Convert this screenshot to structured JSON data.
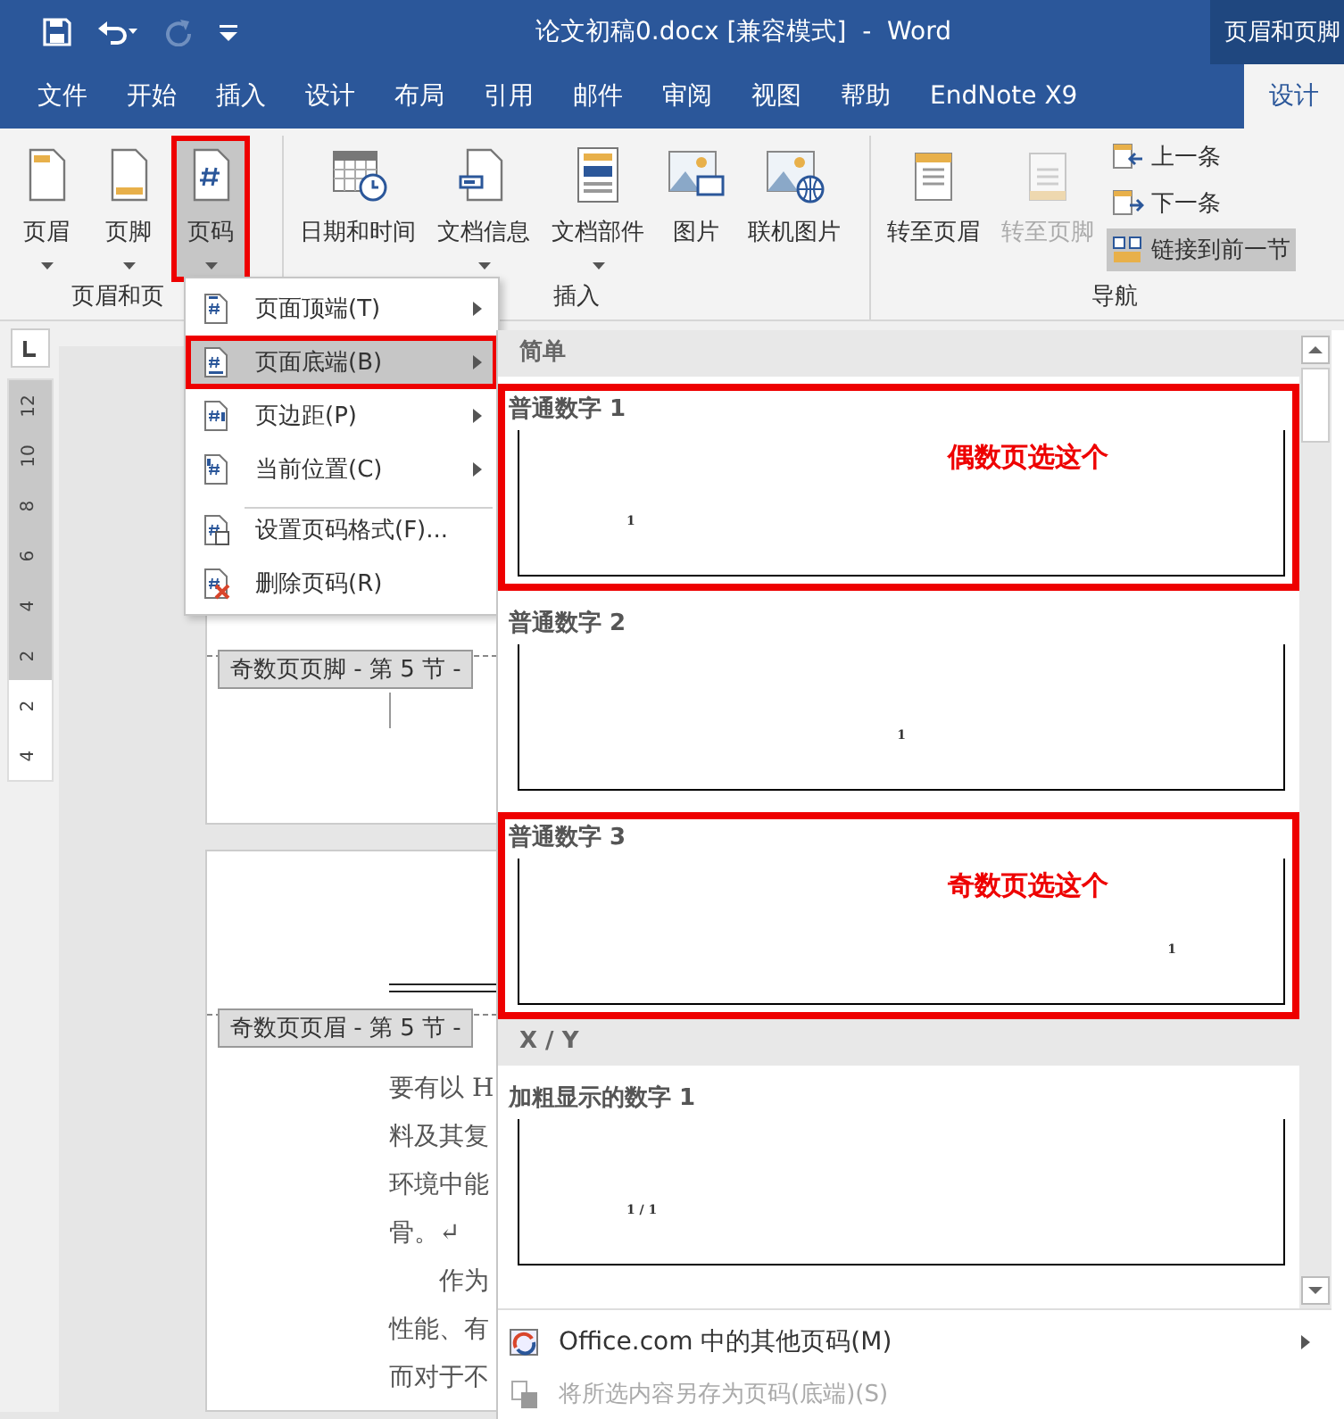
{
  "window": {
    "title": "论文初稿0.docx [兼容模式]  -  Word",
    "context_tab_group": "页眉和页脚"
  },
  "quick_access": [
    {
      "kind": "save",
      "disabled": false
    },
    {
      "kind": "undo",
      "disabled": false
    },
    {
      "kind": "redo",
      "disabled": true
    },
    {
      "kind": "customize",
      "disabled": false
    }
  ],
  "tabs": [
    {
      "label": "文件",
      "selected": false,
      "contextual": false
    },
    {
      "label": "开始",
      "selected": false,
      "contextual": false
    },
    {
      "label": "插入",
      "selected": false,
      "contextual": false
    },
    {
      "label": "设计",
      "selected": false,
      "contextual": false
    },
    {
      "label": "布局",
      "selected": false,
      "contextual": false
    },
    {
      "label": "引用",
      "selected": false,
      "contextual": false
    },
    {
      "label": "邮件",
      "selected": false,
      "contextual": false
    },
    {
      "label": "审阅",
      "selected": false,
      "contextual": false
    },
    {
      "label": "视图",
      "selected": false,
      "contextual": false
    },
    {
      "label": "帮助",
      "selected": false,
      "contextual": false
    },
    {
      "label": "EndNote X9",
      "selected": false,
      "contextual": false
    },
    {
      "label": "设计",
      "selected": true,
      "contextual": true
    }
  ],
  "ribbon": {
    "groups": [
      {
        "label": "页眉和页",
        "buttons": [
          {
            "kind": "header",
            "label": "页眉",
            "dropdown": true,
            "pressed": false,
            "highlighted": false,
            "disabled": false
          },
          {
            "kind": "footer",
            "label": "页脚",
            "dropdown": true,
            "pressed": false,
            "highlighted": false,
            "disabled": false
          },
          {
            "kind": "page-number",
            "label": "页码",
            "dropdown": true,
            "pressed": true,
            "highlighted": true,
            "disabled": false
          }
        ]
      },
      {
        "label": "插入",
        "buttons": [
          {
            "kind": "calendar",
            "label": "日期和时间",
            "dropdown": false,
            "pressed": false,
            "highlighted": false,
            "disabled": false
          },
          {
            "kind": "doc-info",
            "label": "文档信息",
            "dropdown": true,
            "pressed": false,
            "highlighted": false,
            "disabled": false
          },
          {
            "kind": "doc-parts",
            "label": "文档部件",
            "dropdown": true,
            "pressed": false,
            "highlighted": false,
            "disabled": false
          },
          {
            "kind": "picture",
            "label": "图片",
            "dropdown": false,
            "pressed": false,
            "highlighted": false,
            "disabled": false
          },
          {
            "kind": "online-picture",
            "label": "联机图片",
            "dropdown": false,
            "pressed": false,
            "highlighted": false,
            "disabled": false
          }
        ]
      },
      {
        "label": "导航",
        "buttons": [
          {
            "kind": "goto-header",
            "label": "转至页眉",
            "dropdown": false,
            "pressed": false,
            "highlighted": false,
            "disabled": false
          },
          {
            "kind": "goto-footer",
            "label": "转至页脚",
            "dropdown": false,
            "pressed": false,
            "highlighted": false,
            "disabled": true
          },
          {
            "kind": "previous",
            "label": "上一条",
            "pressed": false,
            "disabled": false
          },
          {
            "kind": "next",
            "label": "下一条",
            "pressed": false,
            "disabled": false
          },
          {
            "kind": "link",
            "label": "链接到前一节",
            "pressed": true,
            "disabled": false
          }
        ]
      }
    ]
  },
  "page_number_menu": {
    "items": [
      {
        "kind": "top",
        "label": "页面顶端(T)",
        "submenu": true,
        "separator_before": false,
        "selected": false,
        "highlighted": false
      },
      {
        "kind": "bottom",
        "label": "页面底端(B)",
        "submenu": true,
        "separator_before": false,
        "selected": true,
        "highlighted": true
      },
      {
        "kind": "margin",
        "label": "页边距(P)",
        "submenu": true,
        "separator_before": false,
        "selected": false,
        "highlighted": false
      },
      {
        "kind": "current",
        "label": "当前位置(C)",
        "submenu": true,
        "separator_before": false,
        "selected": false,
        "highlighted": false
      },
      {
        "kind": "format",
        "label": "设置页码格式(F)...",
        "submenu": false,
        "separator_before": true,
        "selected": false,
        "highlighted": false
      },
      {
        "kind": "delete",
        "label": "删除页码(R)",
        "submenu": false,
        "separator_before": false,
        "selected": false,
        "highlighted": false
      }
    ]
  },
  "gallery": {
    "sections": [
      {
        "heading": "简单",
        "items": [
          {
            "kind": "left",
            "label": "普通数字 1",
            "sample": "1",
            "highlighted": true,
            "note": "偶数页选这个"
          },
          {
            "kind": "center",
            "label": "普通数字 2",
            "sample": "1",
            "highlighted": false
          },
          {
            "kind": "right",
            "label": "普通数字 3",
            "sample": "1",
            "highlighted": true,
            "note": "奇数页选这个"
          }
        ]
      },
      {
        "heading": "X / Y",
        "items": [
          {
            "kind": "left",
            "label": "加粗显示的数字 1",
            "sample": "1 / 1",
            "highlighted": false
          }
        ]
      }
    ],
    "footer_items": [
      {
        "kind": "office",
        "label": "Office.com 中的其他页码(M)",
        "submenu": true,
        "disabled": false
      },
      {
        "kind": "save",
        "label": "将所选内容另存为页码(底端)(S)",
        "submenu": false,
        "disabled": true
      }
    ]
  },
  "document": {
    "vertical_ruler": [
      {
        "label": "12",
        "margin": true
      },
      {
        "label": "10",
        "margin": true
      },
      {
        "label": "8",
        "margin": true
      },
      {
        "label": "6",
        "margin": true
      },
      {
        "label": "4",
        "margin": true
      },
      {
        "label": "2",
        "margin": true
      },
      {
        "label": "2",
        "margin": false
      },
      {
        "label": "4",
        "margin": false
      }
    ],
    "pages": [
      {
        "kind": "footer",
        "tag": "奇数页页脚 - 第 5 节 -"
      },
      {
        "kind": "header",
        "tag": "奇数页页眉 - 第 5 节 -",
        "lines": [
          "要有以 H",
          "料及其复",
          "环境中能",
          "骨。↵",
          "　　作为",
          "性能、有",
          "而对于不"
        ]
      }
    ]
  }
}
